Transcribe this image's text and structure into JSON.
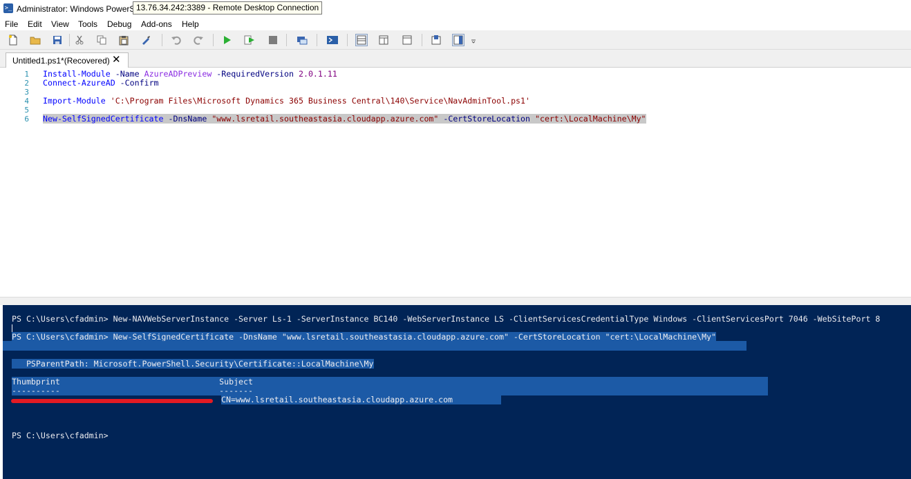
{
  "window": {
    "title": "Administrator: Windows PowerS",
    "rdp_tooltip": "13.76.34.242:3389 - Remote Desktop Connection",
    "app_icon": ">_"
  },
  "menu": [
    "File",
    "Edit",
    "View",
    "Tools",
    "Debug",
    "Add-ons",
    "Help"
  ],
  "toolbar_icons": [
    "new-file-icon",
    "open-folder-icon",
    "save-icon",
    "cut-icon",
    "copy-icon",
    "paste-icon",
    "clear-icon",
    "undo-icon",
    "redo-icon",
    "run-icon",
    "run-selection-icon",
    "stop-icon",
    "remote-session-icon",
    "powershell-console-icon",
    "layout-top-icon",
    "layout-right-icon",
    "layout-max-icon",
    "snippets-icon",
    "command-pane-icon"
  ],
  "tab": {
    "label": "Untitled1.ps1*(Recovered)",
    "close": "✕"
  },
  "editor": {
    "line_numbers": [
      "1",
      "2",
      "3",
      "4",
      "5",
      "6"
    ],
    "line1": {
      "cmd": "Install-Module",
      "p1": " -Name",
      "a1": " AzureADPreview",
      "p2": " -RequiredVersion",
      "n1": " 2.0.1.11"
    },
    "line2": {
      "cmd": "Connect-AzureAD",
      "p1": " -Confirm"
    },
    "line4": {
      "cmd": "Import-Module",
      "s1": " 'C:\\Program Files\\Microsoft Dynamics 365 Business Central\\140\\Service\\NavAdminTool.ps1'"
    },
    "line6": {
      "cmd": "New-SelfSignedCertificate",
      "p1": " -DnsName",
      "s1": " \"www.lsretail.southeastasia.cloudapp.azure.com\"",
      "p2": " -CertStoreLocation",
      "s2": " \"cert:\\LocalMachine\\My\""
    }
  },
  "console": {
    "line1": "PS C:\\Users\\cfadmin> New-NAVWebServerInstance -Server Ls-1 -ServerInstance BC140 -WebServerInstance LS -ClientServicesCredentialType Windows -ClientServicesPort 7046 -WebSitePort 8",
    "line2": "PS C:\\Users\\cfadmin> New-SelfSignedCertificate -DnsName \"www.lsretail.southeastasia.cloudapp.azure.com\" -CertStoreLocation \"cert:\\LocalMachine\\My\"",
    "line3": "   PSParentPath: Microsoft.PowerShell.Security\\Certificate::LocalMachine\\My",
    "header": "Thumbprint                                 Subject",
    "dashes": "----------                                 -------",
    "subject": "CN=www.lsretail.southeastasia.cloudapp.azure.com",
    "prompt": "PS C:\\Users\\cfadmin>"
  },
  "colors": {
    "console_bg": "#012456",
    "selection": "#1c5aa6",
    "redaction": "#e31b23"
  }
}
